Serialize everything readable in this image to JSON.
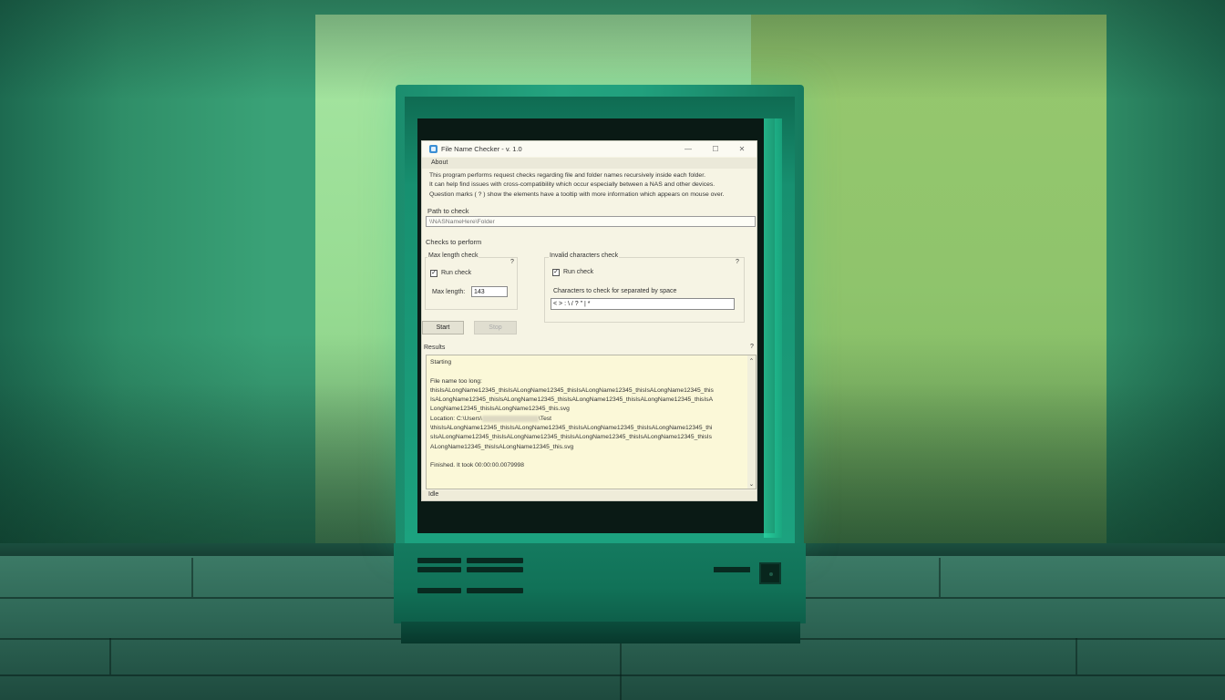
{
  "window": {
    "title": "File Name Checker - v. 1.0",
    "controls": [
      "—",
      "☐",
      "✕"
    ]
  },
  "menu": {
    "about": "About"
  },
  "description": [
    "This program performs request checks regarding file and folder names recursively inside each folder.",
    "It can help find issues with cross-compatibility which occur especially between a NAS and other devices.",
    "Question marks ( ? ) show the elements have a tooltip with more information which appears on mouse over."
  ],
  "path": {
    "label": "Path to check",
    "placeholder": "\\\\NASNameHere\\Folder"
  },
  "checks": {
    "label": "Checks to perform",
    "max_length": {
      "title": "Max length check",
      "help": "?",
      "run_label": "Run check",
      "run_checked": true,
      "max_label": "Max length:",
      "max_value": "143"
    },
    "invalid_chars": {
      "title": "Invalid characters check",
      "help": "?",
      "run_label": "Run check",
      "run_checked": true,
      "chars_label": "Characters to check for separated by space",
      "chars_value": "< > : \\ / ? \" | *"
    }
  },
  "buttons": {
    "start": "Start",
    "stop": "Stop"
  },
  "results": {
    "label": "Results",
    "help": "?",
    "lines": [
      "Starting",
      "",
      "File name too long:",
      "thisIsALongName12345_thisIsALongName12345_thisIsALongName12345_thisIsALongName12345_this",
      "IsALongName12345_thisIsALongName12345_thisIsALongName12345_thisIsALongName12345_thisIsA",
      "LongName12345_thisIsALongName12345_this.svg",
      "",
      "\\thisIsALongName12345_thisIsALongName12345_thisIsALongName12345_thisIsALongName12345_thi",
      "sIsALongName12345_thisIsALongName12345_thisIsALongName12345_thisIsALongName12345_thisIs",
      "ALongName12345_thisIsALongName12345_this.svg",
      "",
      "Finished. It took 00:00:00.0079998"
    ],
    "location_prefix": "Location: C:\\Users\\",
    "location_suffix": "\\Test"
  },
  "status": "Idle"
}
